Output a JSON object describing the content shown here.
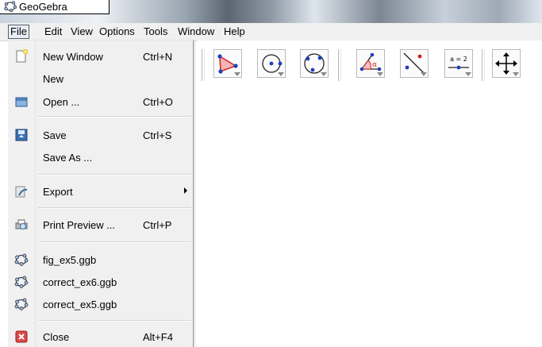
{
  "app": {
    "title": "GeoGebra"
  },
  "menubar": {
    "items": [
      "File",
      "Edit",
      "View",
      "Options",
      "Tools",
      "Window",
      "Help"
    ]
  },
  "file_menu": {
    "items": [
      {
        "label": "New Window",
        "shortcut": "Ctrl+N",
        "icon": "new-window-icon"
      },
      {
        "label": "New",
        "shortcut": "",
        "icon": ""
      },
      {
        "label": "Open ...",
        "shortcut": "Ctrl+O",
        "icon": "folder-open-icon"
      },
      {
        "label": "Save",
        "shortcut": "Ctrl+S",
        "icon": "save-icon"
      },
      {
        "label": "Save As ...",
        "shortcut": "",
        "icon": ""
      },
      {
        "label": "Export",
        "shortcut": "",
        "icon": "export-icon",
        "submenu": true
      },
      {
        "label": "Print Preview ...",
        "shortcut": "Ctrl+P",
        "icon": "print-preview-icon"
      },
      {
        "label": "fig_ex5.ggb",
        "shortcut": "",
        "icon": "geogebra-file-icon"
      },
      {
        "label": "correct_ex6.ggb",
        "shortcut": "",
        "icon": "geogebra-file-icon"
      },
      {
        "label": "correct_ex5.ggb",
        "shortcut": "",
        "icon": "geogebra-file-icon"
      },
      {
        "label": "Close",
        "shortcut": "Alt+F4",
        "icon": "close-icon"
      }
    ]
  },
  "toolbar": {
    "tools": [
      {
        "name": "polygon-tool"
      },
      {
        "name": "circle-tool"
      },
      {
        "name": "circle-three-points-tool"
      },
      {
        "name": "angle-tool"
      },
      {
        "name": "reflect-tool"
      },
      {
        "name": "slider-tool",
        "label": "a = 2"
      },
      {
        "name": "move-graphics-tool"
      }
    ]
  },
  "colors": {
    "accent_point": "#1f3fbf",
    "red": "#d42020",
    "menu_bg": "#f0f0f0"
  }
}
